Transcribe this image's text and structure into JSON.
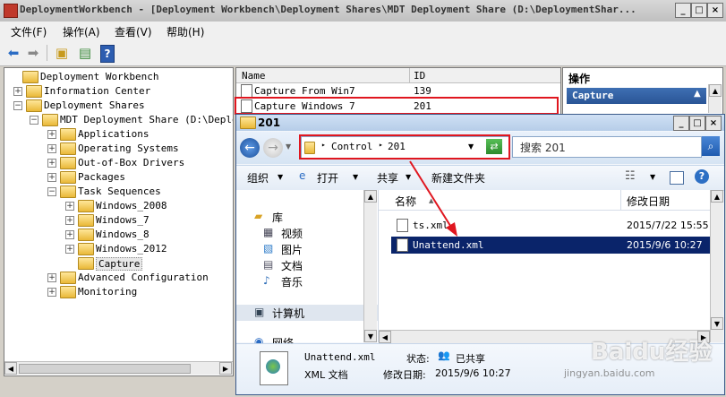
{
  "window": {
    "title": "DeploymentWorkbench - [Deployment Workbench\\Deployment Shares\\MDT Deployment Share (D:\\DeploymentShar..."
  },
  "menu": [
    "文件(F)",
    "操作(A)",
    "查看(V)",
    "帮助(H)"
  ],
  "tree": {
    "items": [
      {
        "label": "Deployment Workbench",
        "level": 0,
        "expander": ""
      },
      {
        "label": "Information Center",
        "level": 1,
        "expander": "+"
      },
      {
        "label": "Deployment Shares",
        "level": 1,
        "expander": "−"
      },
      {
        "label": "MDT Deployment Share (D:\\Deploym",
        "level": 2,
        "expander": "−"
      },
      {
        "label": "Applications",
        "level": 3,
        "expander": "+"
      },
      {
        "label": "Operating Systems",
        "level": 3,
        "expander": "+"
      },
      {
        "label": "Out-of-Box Drivers",
        "level": 3,
        "expander": "+"
      },
      {
        "label": "Packages",
        "level": 3,
        "expander": "+"
      },
      {
        "label": "Task Sequences",
        "level": 3,
        "expander": "−"
      },
      {
        "label": "Windows_2008",
        "level": 4,
        "expander": "+"
      },
      {
        "label": "Windows_7",
        "level": 4,
        "expander": "+"
      },
      {
        "label": "Windows_8",
        "level": 4,
        "expander": "+"
      },
      {
        "label": "Windows_2012",
        "level": 4,
        "expander": "+"
      },
      {
        "label": "Capture",
        "level": 4,
        "expander": ""
      },
      {
        "label": "Advanced Configuration",
        "level": 3,
        "expander": "+"
      },
      {
        "label": "Monitoring",
        "level": 3,
        "expander": "+"
      }
    ]
  },
  "list": {
    "columns": [
      "Name",
      "ID"
    ],
    "rows": [
      {
        "name": "Capture From Win7",
        "id": "139"
      },
      {
        "name": "Capture Windows 7",
        "id": "201"
      }
    ]
  },
  "actions": {
    "header": "操作",
    "item": "Capture"
  },
  "explorer": {
    "title": "201",
    "breadcrumb": [
      "Control",
      "201"
    ],
    "search_placeholder": "搜索 201",
    "commands": [
      "组织",
      "打开",
      "共享",
      "新建文件夹"
    ],
    "nav": {
      "library": "库",
      "items": [
        "视频",
        "图片",
        "文档",
        "音乐"
      ],
      "computer": "计算机",
      "network": "网络"
    },
    "columns": [
      "名称",
      "修改日期"
    ],
    "files": [
      {
        "name": "ts.xml",
        "date": "2015/7/22 15:55"
      },
      {
        "name": "Unattend.xml",
        "date": "2015/9/6 10:27"
      }
    ],
    "details": {
      "name": "Unattend.xml",
      "type": "XML 文档",
      "state_label": "状态:",
      "state_value": "已共享",
      "modified_label": "修改日期:",
      "modified_value": "2015/9/6 10:27"
    }
  },
  "watermark": {
    "brand": "Baidu经验",
    "url": "jingyan.baidu.com"
  },
  "colors": {
    "selection": "#0a246a",
    "highlight_box": "#e0161f",
    "action_item": "#2a5596"
  }
}
